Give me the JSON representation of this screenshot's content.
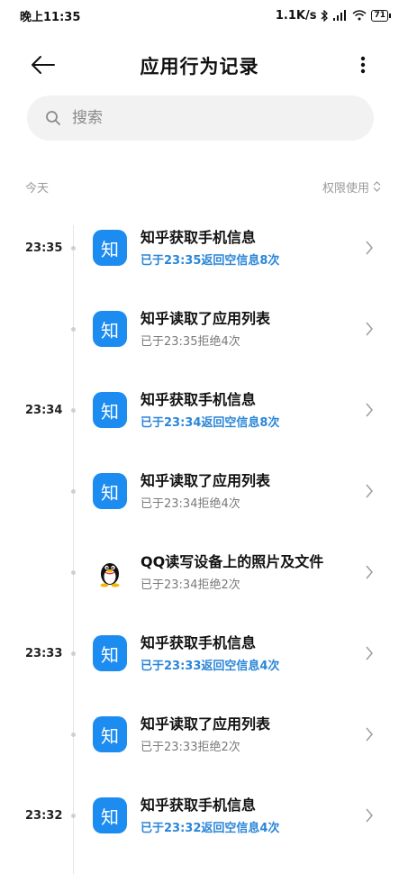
{
  "status_bar": {
    "time": "晚上11:35",
    "speed": "1.1K/s",
    "battery": "71",
    "icons": [
      "bluetooth-icon",
      "signal-icon",
      "wifi-icon",
      "battery-icon"
    ]
  },
  "header": {
    "title": "应用行为记录",
    "back_icon": "arrow-left-icon",
    "more_icon": "more-vertical-icon"
  },
  "search": {
    "placeholder": "搜索",
    "icon": "search-icon"
  },
  "section": {
    "label": "今天",
    "filter": "权限使用"
  },
  "colors": {
    "accent": "#2a86d8",
    "app_blue": "#1c8cf0"
  },
  "records": [
    {
      "time": "23:35",
      "app": "知",
      "title": "知乎获取手机信息",
      "detail": "已于23:35返回空信息8次",
      "highlight": true
    },
    {
      "time": "",
      "app": "知",
      "title": "知乎读取了应用列表",
      "detail": "已于23:35拒绝4次",
      "highlight": false
    },
    {
      "time": "23:34",
      "app": "知",
      "title": "知乎获取手机信息",
      "detail": "已于23:34返回空信息8次",
      "highlight": true
    },
    {
      "time": "",
      "app": "知",
      "title": "知乎读取了应用列表",
      "detail": "已于23:34拒绝4次",
      "highlight": false
    },
    {
      "time": "",
      "app": "qq",
      "title": "QQ读写设备上的照片及文件",
      "detail": "已于23:34拒绝2次",
      "highlight": false
    },
    {
      "time": "23:33",
      "app": "知",
      "title": "知乎获取手机信息",
      "detail": "已于23:33返回空信息4次",
      "highlight": true
    },
    {
      "time": "",
      "app": "知",
      "title": "知乎读取了应用列表",
      "detail": "已于23:33拒绝2次",
      "highlight": false
    },
    {
      "time": "23:32",
      "app": "知",
      "title": "知乎获取手机信息",
      "detail": "已于23:32返回空信息4次",
      "highlight": true
    }
  ]
}
